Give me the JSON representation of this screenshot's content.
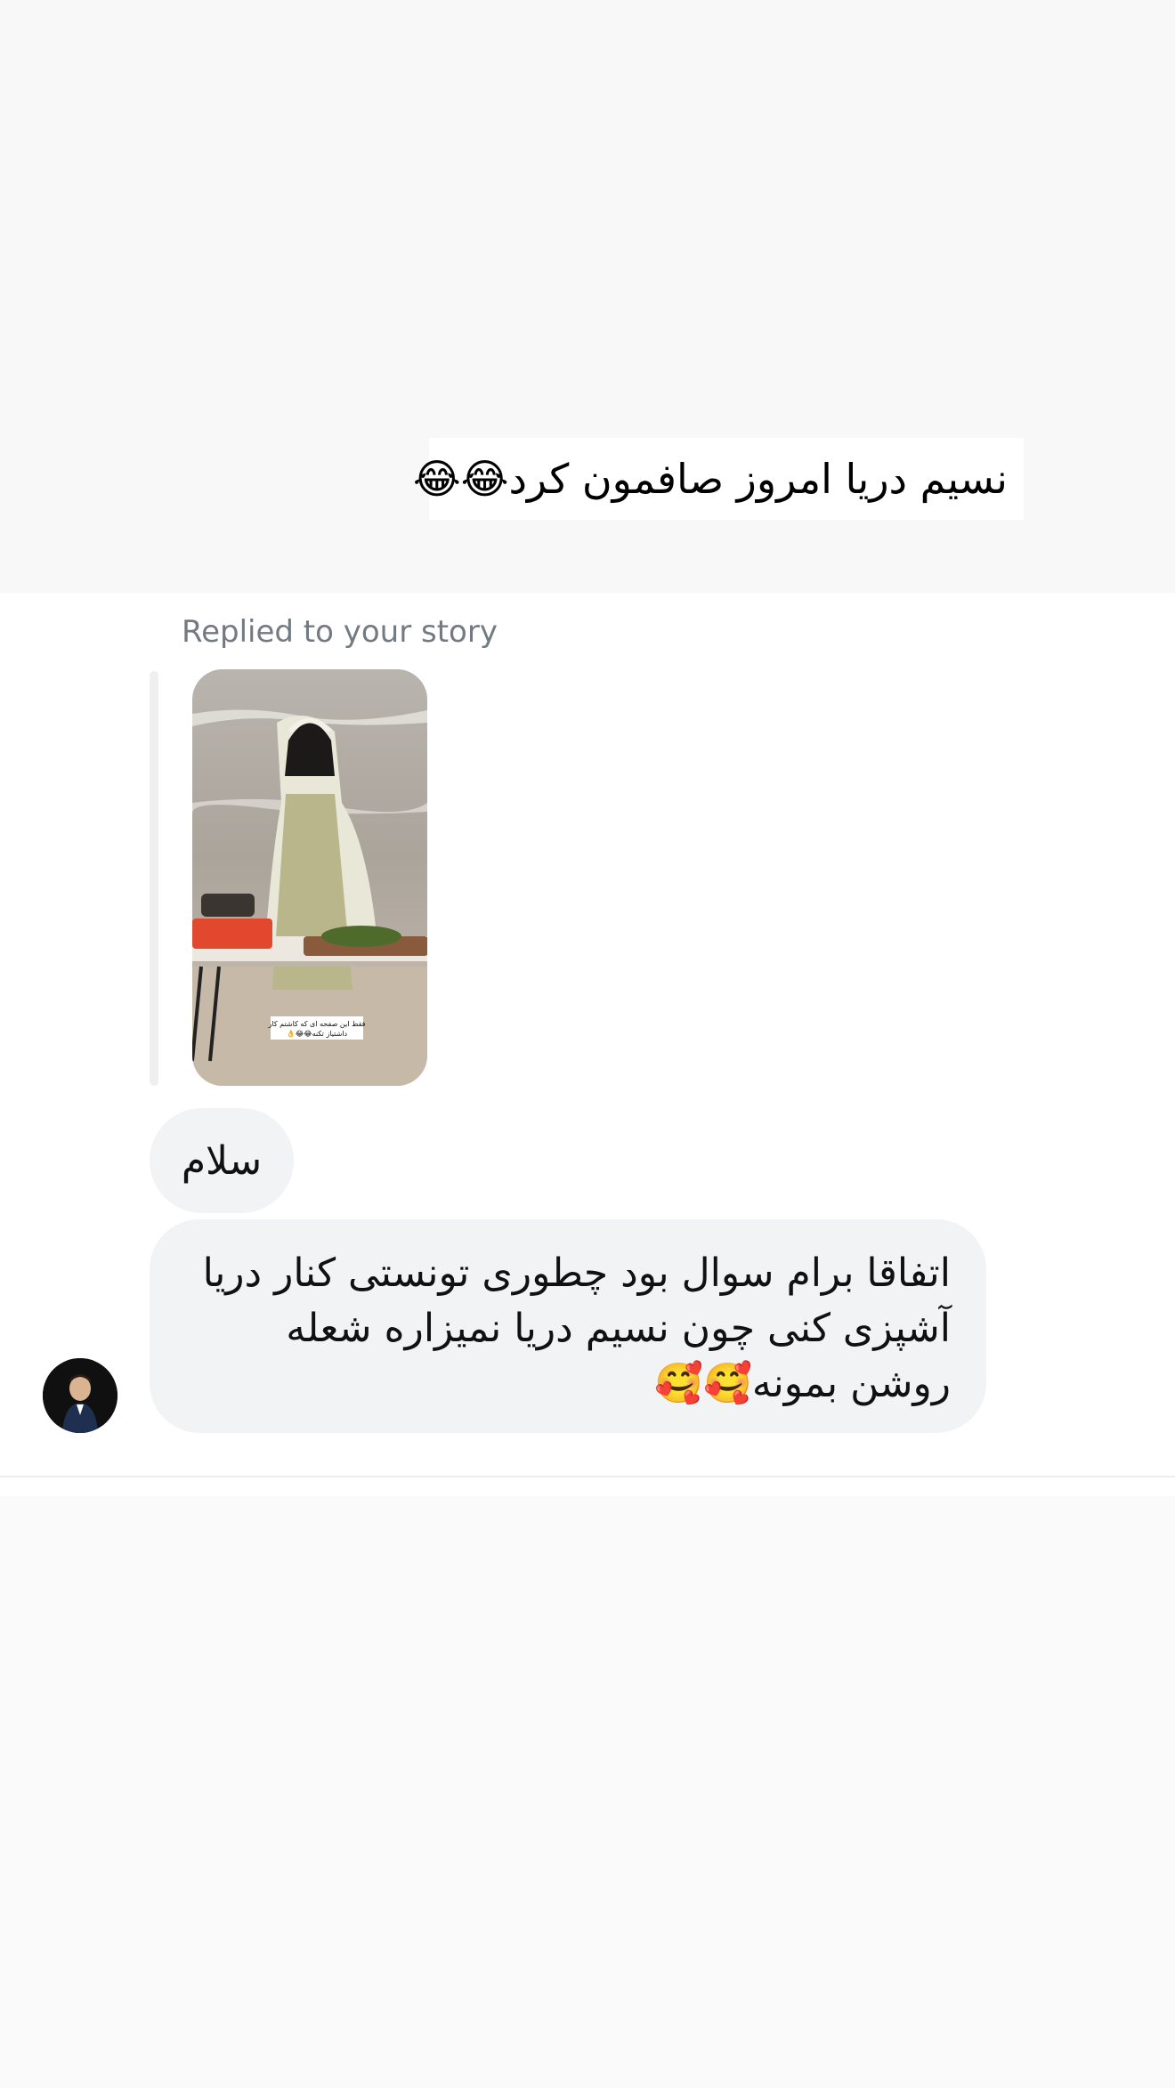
{
  "story_caption": {
    "text": "نسیم دریا امروز صافمون کرد😂😂"
  },
  "chat": {
    "reply_label": "Replied to your story",
    "story_thumbnail": {
      "icon": "story-image",
      "overlay_text_line1": "فقط این صفحه ای که کاشتم کار",
      "overlay_text_line2": "داشتیاز تکنه😂😂👌"
    },
    "messages": [
      {
        "text": "سلام"
      },
      {
        "text": "اتفاقا برام سوال بود چطوری تونستی کنار دریا آشپزی کنی چون نسیم دریا نمیزاره شعله روشن بمونه🥰🥰"
      }
    ],
    "sender_avatar": {
      "icon": "avatar-photo"
    }
  }
}
